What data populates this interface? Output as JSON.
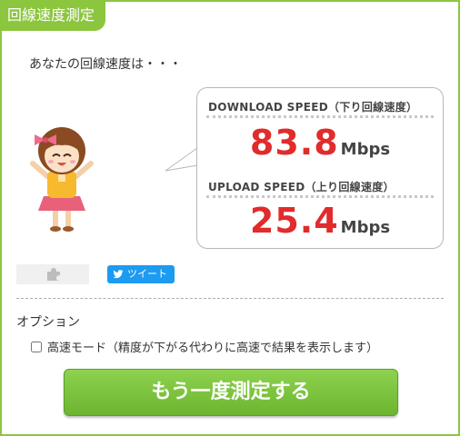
{
  "header": {
    "title": "回線速度測定"
  },
  "intro": {
    "text": "あなたの回線速度は・・・"
  },
  "result": {
    "download": {
      "label": "DOWNLOAD SPEED（下り回線速度）",
      "value": "83.8",
      "unit": "Mbps"
    },
    "upload": {
      "label": "UPLOAD SPEED（上り回線速度）",
      "value": "25.4",
      "unit": "Mbps"
    }
  },
  "share": {
    "tweet_label": "ツイート",
    "plugin_icon": "puzzle-icon"
  },
  "options": {
    "title": "オプション",
    "fast_mode": {
      "label": "高速モード（精度が下がる代わりに高速で結果を表示します）",
      "checked": false
    }
  },
  "actions": {
    "retest_label": "もう一度測定する"
  },
  "colors": {
    "brand_green": "#8cc63f",
    "speed_red": "#e22b2b",
    "twitter_blue": "#1d9bf0"
  }
}
